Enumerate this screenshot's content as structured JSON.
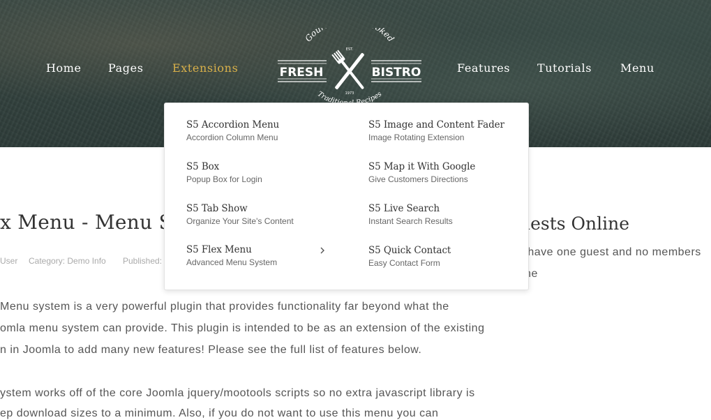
{
  "nav": {
    "items": [
      {
        "label": "Home"
      },
      {
        "label": "Pages"
      },
      {
        "label": "Extensions"
      },
      {
        "label": "Features"
      },
      {
        "label": "Tutorials"
      },
      {
        "label": "Menu"
      }
    ],
    "active_color": "#d8b04a"
  },
  "logo": {
    "top_text": "Gourmet SlowCooked",
    "left_text": "FRESH",
    "right_text": "BISTRO",
    "est": "EST.",
    "year": "1973",
    "bottom_text": "Traditional Recipes",
    "icon": "fork-knife-icon"
  },
  "dropdown": {
    "items": [
      {
        "title": "S5 Accordion Menu",
        "sub": "Accordion Column Menu"
      },
      {
        "title": "S5 Box",
        "sub": "Popup Box for Login"
      },
      {
        "title": "S5 Tab Show",
        "sub": "Organize Your Site's Content"
      },
      {
        "title": "S5 Flex Menu",
        "sub": "Advanced Menu System",
        "icon": "chevron-right-icon"
      },
      {
        "title": "S5 Image and Content Fader",
        "sub": "Image Rotating Extension"
      },
      {
        "title": "S5 Map it With Google",
        "sub": "Give Customers Directions"
      },
      {
        "title": "S5 Live Search",
        "sub": "Instant Search Results"
      },
      {
        "title": "S5 Quick Contact",
        "sub": "Easy Contact Form"
      }
    ]
  },
  "article": {
    "title": "x Menu - Menu S",
    "meta": {
      "author": "User",
      "category": "Category: Demo Info",
      "published": "Published:"
    },
    "paragraph1": [
      "Menu system is a very powerful plugin that provides functionality far beyond what the",
      "omla menu system can provide. This plugin is intended to be as an extension of the existing",
      "n in Joomla to add many new features! Please see the full list of features below."
    ],
    "paragraph2": [
      "ystem works off of the core Joomla jquery/mootools scripts so no extra javascript library is",
      "ep download sizes to a minimum. Also, if you do not want to use this menu you can"
    ]
  },
  "sidebar": {
    "title": "uests Online",
    "lines": [
      "e have one guest and no members",
      "line"
    ]
  }
}
